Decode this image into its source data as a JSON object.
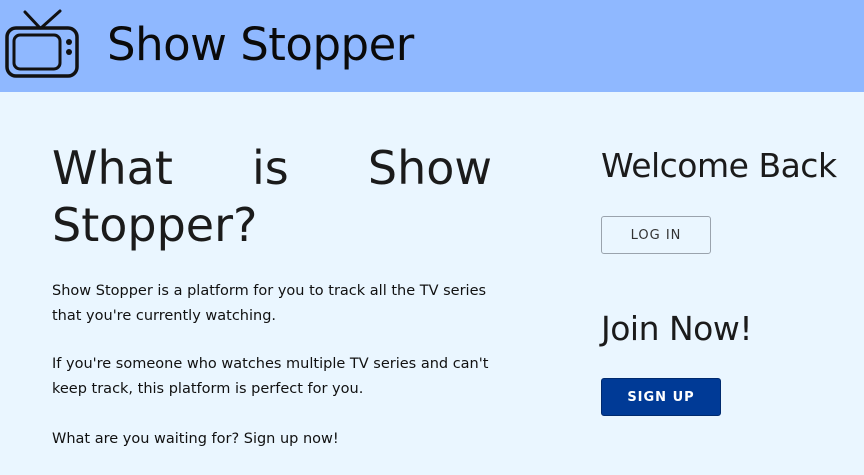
{
  "header": {
    "logo_icon": "tv-icon",
    "title": "Show Stopper",
    "background": "#8fb8ff"
  },
  "intro": {
    "heading": "What is Show Stopper?",
    "paragraphs": [
      "Show Stopper is a platform for you to track all the TV series that you're currently watching.",
      "If you're someone who watches multiple TV series and can't keep track, this platform is perfect for you.",
      "What are you waiting for? Sign up now!"
    ]
  },
  "login": {
    "heading": "Welcome Back",
    "button_label": "LOG IN"
  },
  "signup": {
    "heading": "Join Now!",
    "button_label": "SIGN UP",
    "button_color": "#003a96"
  },
  "colors": {
    "page_background": "#eaf6ff",
    "text": "#1b1b1b"
  }
}
